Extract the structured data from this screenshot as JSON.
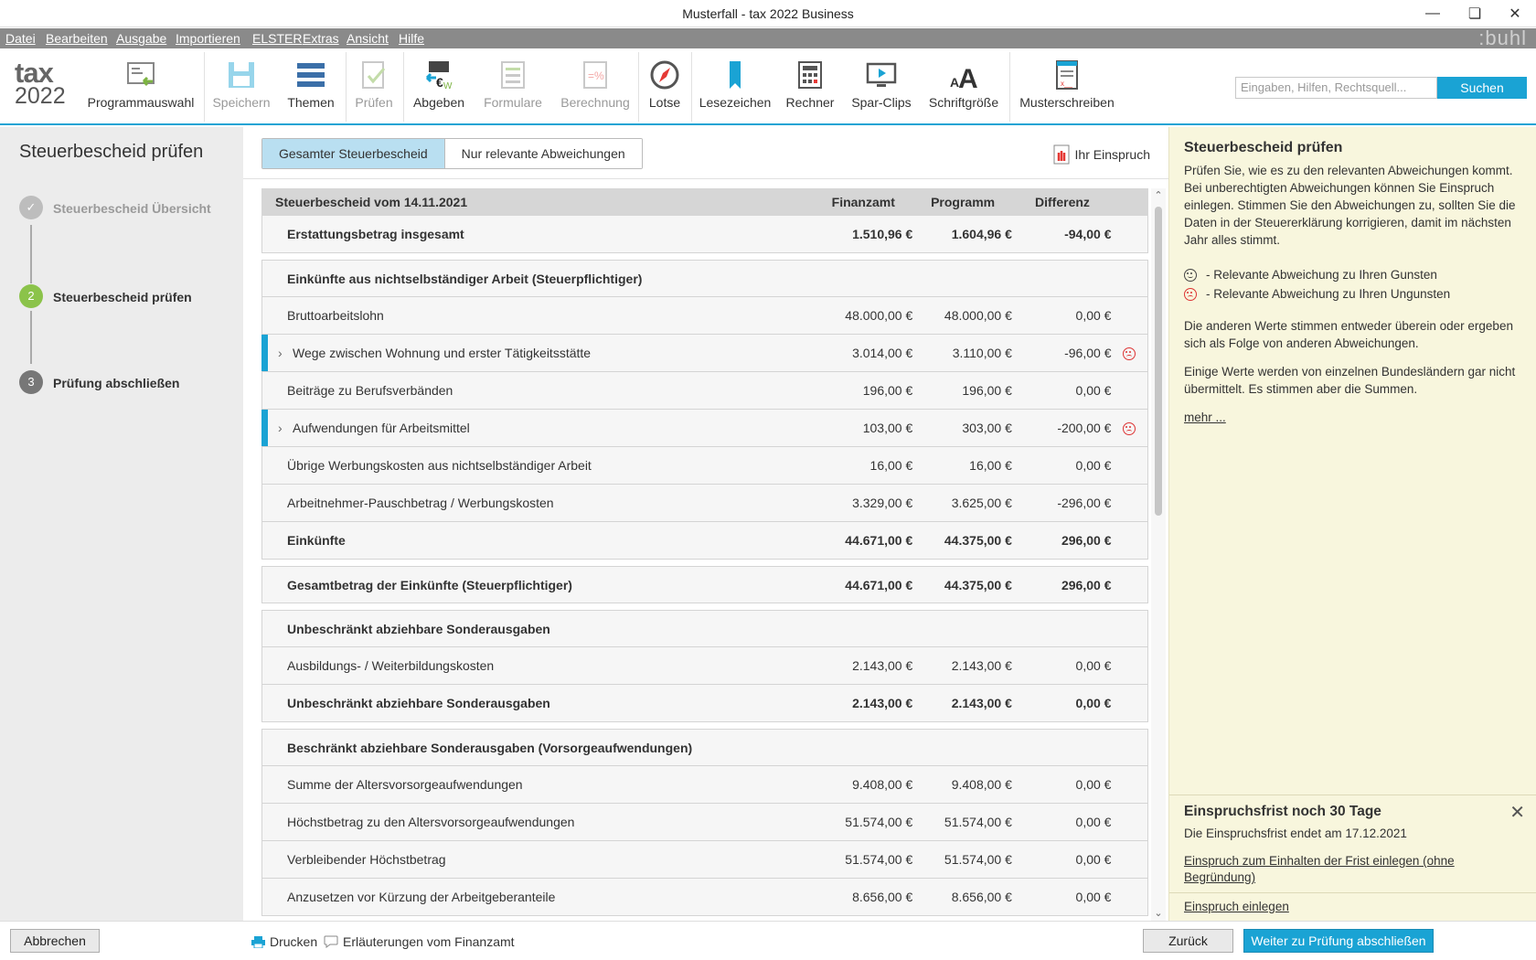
{
  "window": {
    "title": "Musterfall - tax 2022 Business"
  },
  "menu": {
    "items": [
      "Datei",
      "Bearbeiten",
      "Ausgabe",
      "Importieren",
      "ELSTER",
      "Extras",
      "Ansicht",
      "Hilfe"
    ],
    "brand": ":buhl"
  },
  "logo": {
    "line1": "tax",
    "line2": "2022"
  },
  "toolbar": {
    "programmauswahl": "Programmauswahl",
    "speichern": "Speichern",
    "themen": "Themen",
    "pruefen": "Prüfen",
    "abgeben": "Abgeben",
    "formulare": "Formulare",
    "berechnung": "Berechnung",
    "lotse": "Lotse",
    "lesezeichen": "Lesezeichen",
    "rechner": "Rechner",
    "sparclips": "Spar-Clips",
    "schriftgroesse": "Schriftgröße",
    "musterschreiben": "Musterschreiben"
  },
  "search": {
    "placeholder": "Eingaben, Hilfen, Rechtsquell...",
    "button": "Suchen"
  },
  "sidebar": {
    "title": "Steuerbescheid prüfen",
    "steps": [
      {
        "num": "✓",
        "label": "Steuerbescheid Übersicht",
        "state": "done"
      },
      {
        "num": "2",
        "label": "Steuerbescheid prüfen",
        "state": "active"
      },
      {
        "num": "3",
        "label": "Prüfung abschließen",
        "state": "pending"
      }
    ]
  },
  "main": {
    "tabs": [
      "Gesamter Steuerbescheid",
      "Nur relevante Abweichungen"
    ],
    "einspruch": "Ihr Einspruch",
    "header": {
      "label": "Steuerbescheid vom 14.11.2021",
      "fa": "Finanzamt",
      "prog": "Programm",
      "diff": "Differenz"
    },
    "rows": [
      {
        "label": "Erstattungsbetrag insgesamt",
        "fa": "1.510,96 €",
        "prog": "1.604,96 €",
        "diff": "-94,00 €",
        "bold": true,
        "group": false
      },
      {
        "label": "Einkünfte aus nichtselbständiger Arbeit (Steuerpflichtiger)",
        "fa": "",
        "prog": "",
        "diff": "",
        "bold": true,
        "group": true
      },
      {
        "label": "Bruttoarbeitslohn",
        "fa": "48.000,00 €",
        "prog": "48.000,00 €",
        "diff": "0,00 €"
      },
      {
        "label": "Wege zwischen Wohnung und erster Tätigkeitsstätte",
        "fa": "3.014,00 €",
        "prog": "3.110,00 €",
        "diff": "-96,00 €",
        "highlight": true,
        "expand": true,
        "icon": "sad"
      },
      {
        "label": "Beiträge zu Berufsverbänden",
        "fa": "196,00 €",
        "prog": "196,00 €",
        "diff": "0,00 €"
      },
      {
        "label": "Aufwendungen für Arbeitsmittel",
        "fa": "103,00 €",
        "prog": "303,00 €",
        "diff": "-200,00 €",
        "highlight": true,
        "expand": true,
        "icon": "sad"
      },
      {
        "label": "Übrige Werbungskosten aus nichtselbständiger Arbeit",
        "fa": "16,00 €",
        "prog": "16,00 €",
        "diff": "0,00 €"
      },
      {
        "label": "Arbeitnehmer-Pauschbetrag / Werbungskosten",
        "fa": "3.329,00 €",
        "prog": "3.625,00 €",
        "diff": "-296,00 €"
      },
      {
        "label": "Einkünfte",
        "fa": "44.671,00 €",
        "prog": "44.375,00 €",
        "diff": "296,00 €",
        "bold": true
      },
      {
        "label": "Gesamtbetrag der Einkünfte (Steuerpflichtiger)",
        "fa": "44.671,00 €",
        "prog": "44.375,00 €",
        "diff": "296,00 €",
        "bold": true,
        "group": true
      },
      {
        "label": "Unbeschränkt abziehbare Sonderausgaben",
        "fa": "",
        "prog": "",
        "diff": "",
        "bold": true,
        "group": true
      },
      {
        "label": "Ausbildungs- / Weiterbildungskosten",
        "fa": "2.143,00 €",
        "prog": "2.143,00 €",
        "diff": "0,00 €"
      },
      {
        "label": "Unbeschränkt abziehbare Sonderausgaben",
        "fa": "2.143,00 €",
        "prog": "2.143,00 €",
        "diff": "0,00 €",
        "bold": true
      },
      {
        "label": "Beschränkt abziehbare Sonderausgaben (Vorsorgeaufwendungen)",
        "fa": "",
        "prog": "",
        "diff": "",
        "bold": true,
        "group": true
      },
      {
        "label": "Summe der Altersvorsorgeaufwendungen",
        "fa": "9.408,00 €",
        "prog": "9.408,00 €",
        "diff": "0,00 €"
      },
      {
        "label": "Höchstbetrag zu den Altersvorsorgeaufwendungen",
        "fa": "51.574,00 €",
        "prog": "51.574,00 €",
        "diff": "0,00 €"
      },
      {
        "label": "Verbleibender Höchstbetrag",
        "fa": "51.574,00 €",
        "prog": "51.574,00 €",
        "diff": "0,00 €"
      },
      {
        "label": "Anzusetzen vor Kürzung der Arbeitgeberanteile",
        "fa": "8.656,00 €",
        "prog": "8.656,00 €",
        "diff": "0,00 €"
      }
    ]
  },
  "help": {
    "title": "Steuerbescheid prüfen",
    "intro": "Prüfen Sie, wie es zu den relevanten Abweichungen kommt. Bei unberechtigten Abweichungen können Sie Einspruch einlegen. Stimmen Sie den Abweichungen zu, sollten Sie die Daten in der Steuererklärung korrigieren, damit im nächsten Jahr alles stimmt.",
    "legend_good": "- Relevante Abweichung zu Ihren Gunsten",
    "legend_bad": "- Relevante Abweichung zu Ihren Ungunsten",
    "para2": "Die anderen Werte stimmen entweder überein oder ergeben sich als Folge von anderen Abweichungen.",
    "para3": "Einige Werte werden von einzelnen Bundesländern gar nicht übermittelt. Es stimmen aber die Summen.",
    "more": "mehr ...",
    "frist_title": "Einspruchsfrist noch 30 Tage",
    "frist_text": "Die Einspruchsfrist endet am 17.12.2021",
    "frist_link1": "Einspruch zum Einhalten der Frist einlegen (ohne Begründung)",
    "frist_link2": "Einspruch einlegen"
  },
  "bottom": {
    "cancel": "Abbrechen",
    "print": "Drucken",
    "explain": "Erläuterungen vom Finanzamt",
    "back": "Zurück",
    "next": "Weiter zu Prüfung abschließen"
  },
  "colors": {
    "accent": "#1aa3d4",
    "step_done": "#bdbdbd",
    "step_active": "#8bc34a",
    "step_pending": "#777777",
    "help_bg": "#f8f6dd"
  }
}
